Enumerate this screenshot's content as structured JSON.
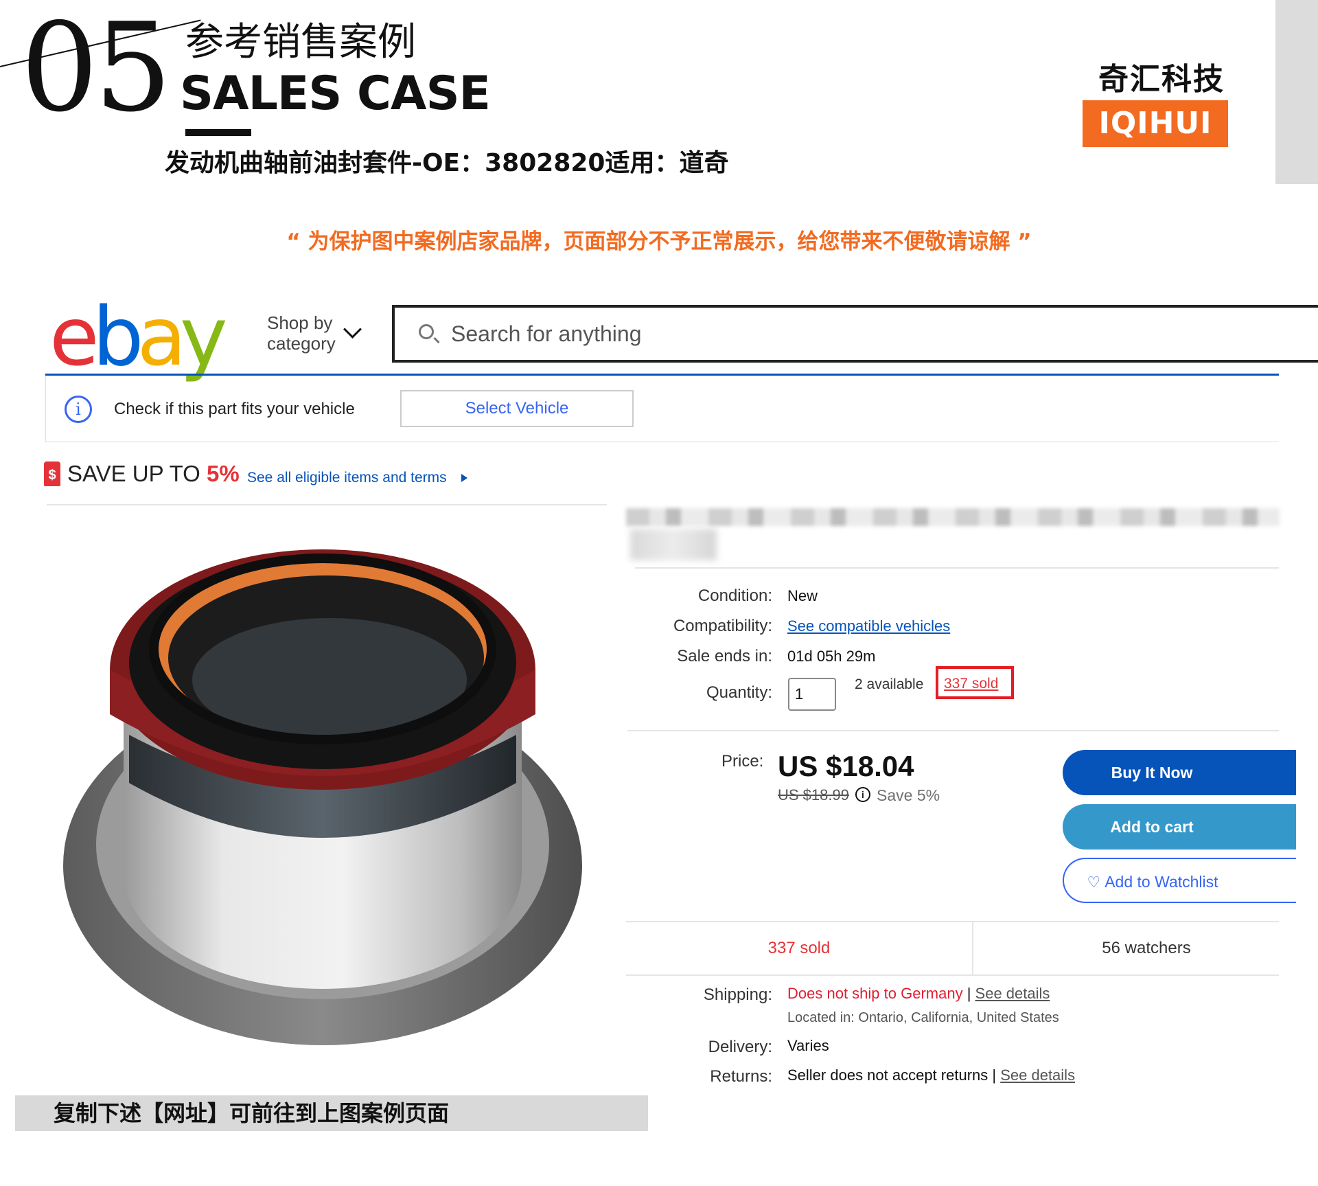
{
  "header": {
    "section_number": "05",
    "title_cn": "参考销售案例",
    "title_en": "SALES CASE",
    "product_title": "发动机曲轴前油封套件-OE：3802820适用：道奇",
    "brand_cn": "奇汇科技",
    "brand_en": "IQIHUI",
    "brand_color": "#f26b21"
  },
  "notice": "“ 为保护图中案例店家品牌，页面部分不予正常展示，给您带来不便敬请谅解 ”",
  "ebay": {
    "logo": {
      "e": "e",
      "b": "b",
      "a": "a",
      "y": "y"
    },
    "shop_by_line1": "Shop by",
    "shop_by_line2": "category",
    "search_placeholder": "Search for anything",
    "fits_text": "Check if this part fits your vehicle",
    "select_vehicle": "Select Vehicle",
    "promo": {
      "text": "SAVE UP TO ",
      "percent": "5%",
      "link": "See all eligible items and terms"
    },
    "details": {
      "condition_label": "Condition:",
      "condition_value": "New",
      "compat_label": "Compatibility:",
      "compat_value": "See compatible vehicles",
      "sale_ends_label": "Sale ends in:",
      "sale_ends_value": "01d 05h 29m",
      "quantity_label": "Quantity:",
      "quantity_value": "1",
      "available": "2 available",
      "sold_link": "337 sold"
    },
    "price": {
      "label": "Price:",
      "current": "US $18.04",
      "original": "US $18.99",
      "save": "Save 5%"
    },
    "buttons": {
      "buy_now": "Buy It Now",
      "add_to_cart": "Add to cart",
      "add_to_watchlist": "Add to Watchlist"
    },
    "stats": {
      "sold": "337 sold",
      "watchers": "56 watchers"
    },
    "shipping": {
      "label": "Shipping:",
      "value": "Does not ship to Germany",
      "separator": " | ",
      "link": "See details",
      "located": "Located in: Ontario, California, United States"
    },
    "delivery": {
      "label": "Delivery:",
      "value": "Varies"
    },
    "returns": {
      "label": "Returns:",
      "value": "Seller does not accept returns | ",
      "link": "See details"
    },
    "colors": {
      "link": "#0654ba",
      "buy_now": "#0654ba",
      "add_to_cart": "#3498ca",
      "alert_red": "#e53238"
    }
  },
  "footer": {
    "copy_hint": "复制下述【网址】可前往到上图案例页面"
  }
}
